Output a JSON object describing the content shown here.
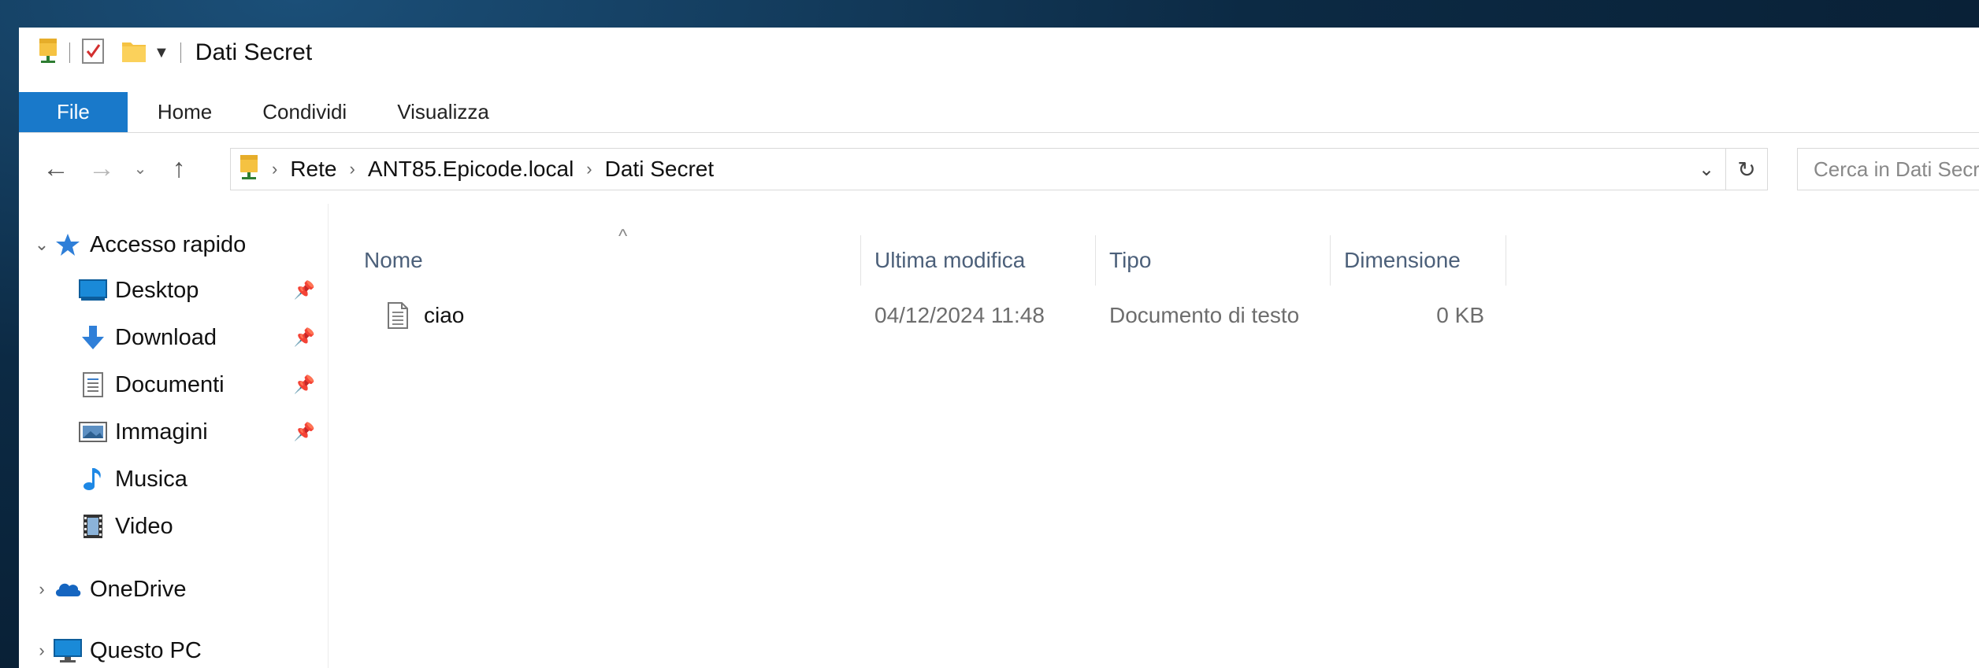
{
  "window": {
    "title": "Dati Secret"
  },
  "ribbon": {
    "tabs": [
      {
        "label": "File"
      },
      {
        "label": "Home"
      },
      {
        "label": "Condividi"
      },
      {
        "label": "Visualizza"
      }
    ]
  },
  "address": {
    "crumbs": [
      "Rete",
      "ANT85.Epicode.local",
      "Dati Secret"
    ]
  },
  "search": {
    "placeholder": "Cerca in Dati Secret"
  },
  "nav": {
    "quick_access": "Accesso rapido",
    "items": [
      {
        "label": "Desktop",
        "icon": "desktop-icon",
        "pinned": true
      },
      {
        "label": "Download",
        "icon": "download-icon",
        "pinned": true
      },
      {
        "label": "Documenti",
        "icon": "documents-icon",
        "pinned": true
      },
      {
        "label": "Immagini",
        "icon": "pictures-icon",
        "pinned": true
      },
      {
        "label": "Musica",
        "icon": "music-icon",
        "pinned": false
      },
      {
        "label": "Video",
        "icon": "video-icon",
        "pinned": false
      }
    ],
    "onedrive": "OneDrive",
    "this_pc": "Questo PC"
  },
  "columns": {
    "name": "Nome",
    "modified": "Ultima modifica",
    "type": "Tipo",
    "size": "Dimensione"
  },
  "files": [
    {
      "name": "ciao",
      "modified": "04/12/2024 11:48",
      "type": "Documento di testo",
      "size": "0 KB"
    }
  ],
  "colors": {
    "accent": "#1979ca",
    "header_text": "#4c607a"
  }
}
